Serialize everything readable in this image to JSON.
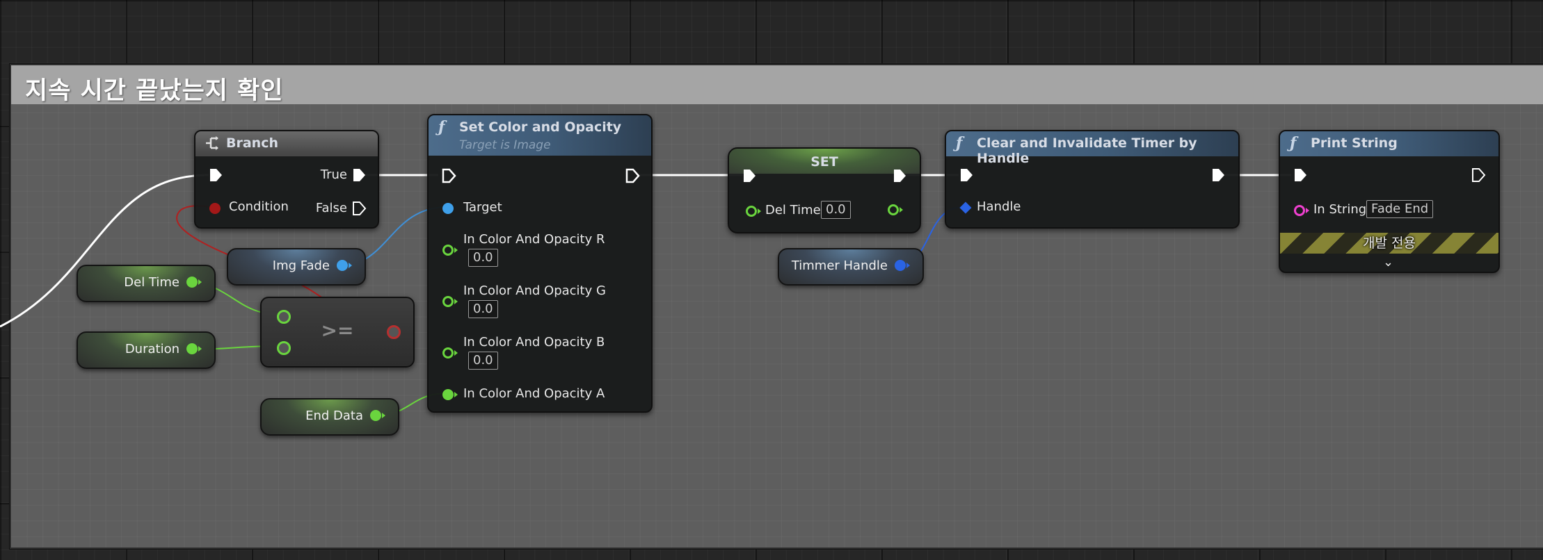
{
  "comment": {
    "title": "지속 시간 끝났는지 확인"
  },
  "colors": {
    "exec": "#ffffff",
    "float_pin": "#6ad53e",
    "object_pin": "#3fa0ea",
    "bool_pin": "#a31818",
    "string_pin": "#f040d0",
    "struct_pin": "#2a63e4",
    "function_header": "#4d6c8b",
    "variable_header": "#6c9a4c",
    "development_stripe": "#868435"
  },
  "nodes": {
    "branch": {
      "title": "Branch",
      "icon": "branch-icon",
      "pins": {
        "condition": "Condition",
        "true": "True",
        "false": "False"
      }
    },
    "set_color": {
      "title": "Set Color and Opacity",
      "subtitle": "Target is Image",
      "icon": "function-icon",
      "pins": {
        "target": "Target",
        "r": "In Color And Opacity R",
        "g": "In Color And Opacity G",
        "b": "In Color And Opacity B",
        "a": "In Color And Opacity A"
      },
      "values": {
        "r": "0.0",
        "g": "0.0",
        "b": "0.0"
      }
    },
    "set_var": {
      "title": "SET",
      "pin": "Del Time",
      "value": "0.0"
    },
    "clear_timer": {
      "title": "Clear and Invalidate Timer by Handle",
      "icon": "function-icon",
      "pin": "Handle"
    },
    "print_string": {
      "title": "Print String",
      "icon": "function-icon",
      "pin": "In String",
      "value": "Fade  End",
      "dev_only": "개발 전용"
    },
    "compare": {
      "operator": ">="
    }
  },
  "variables": {
    "img_fade": "Img Fade",
    "del_time": "Del Time",
    "duration": "Duration",
    "end_data": "End Data",
    "timer_handle": "Timmer Handle"
  }
}
